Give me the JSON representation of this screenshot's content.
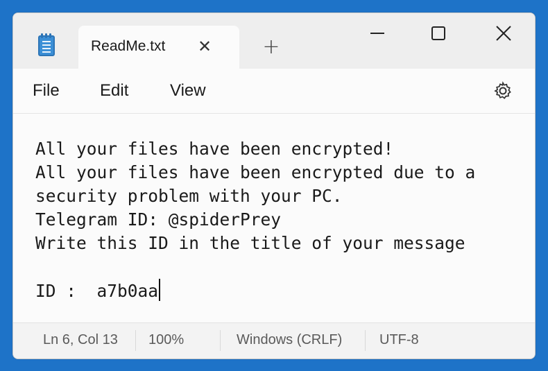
{
  "window": {
    "tab_title": "ReadMe.txt",
    "close_tab_symbol": "✕",
    "new_tab_symbol": "+",
    "app_icon": "notepad-icon"
  },
  "menu": {
    "file": "File",
    "edit": "Edit",
    "view": "View",
    "settings_icon": "gear-icon"
  },
  "document": {
    "lines": [
      "All your files have been encrypted!",
      "All your files have been encrypted due to a",
      "security problem with your PC.",
      "Telegram ID: @spiderPrey",
      "Write this ID in the title of your message",
      "",
      "ID :  a7b0aa"
    ]
  },
  "status": {
    "position": "Ln 6, Col 13",
    "zoom": "100%",
    "line_ending": "Windows (CRLF)",
    "encoding": "UTF-8"
  },
  "colors": {
    "accent": "#3b8fd6",
    "background": "#1e73c8"
  }
}
